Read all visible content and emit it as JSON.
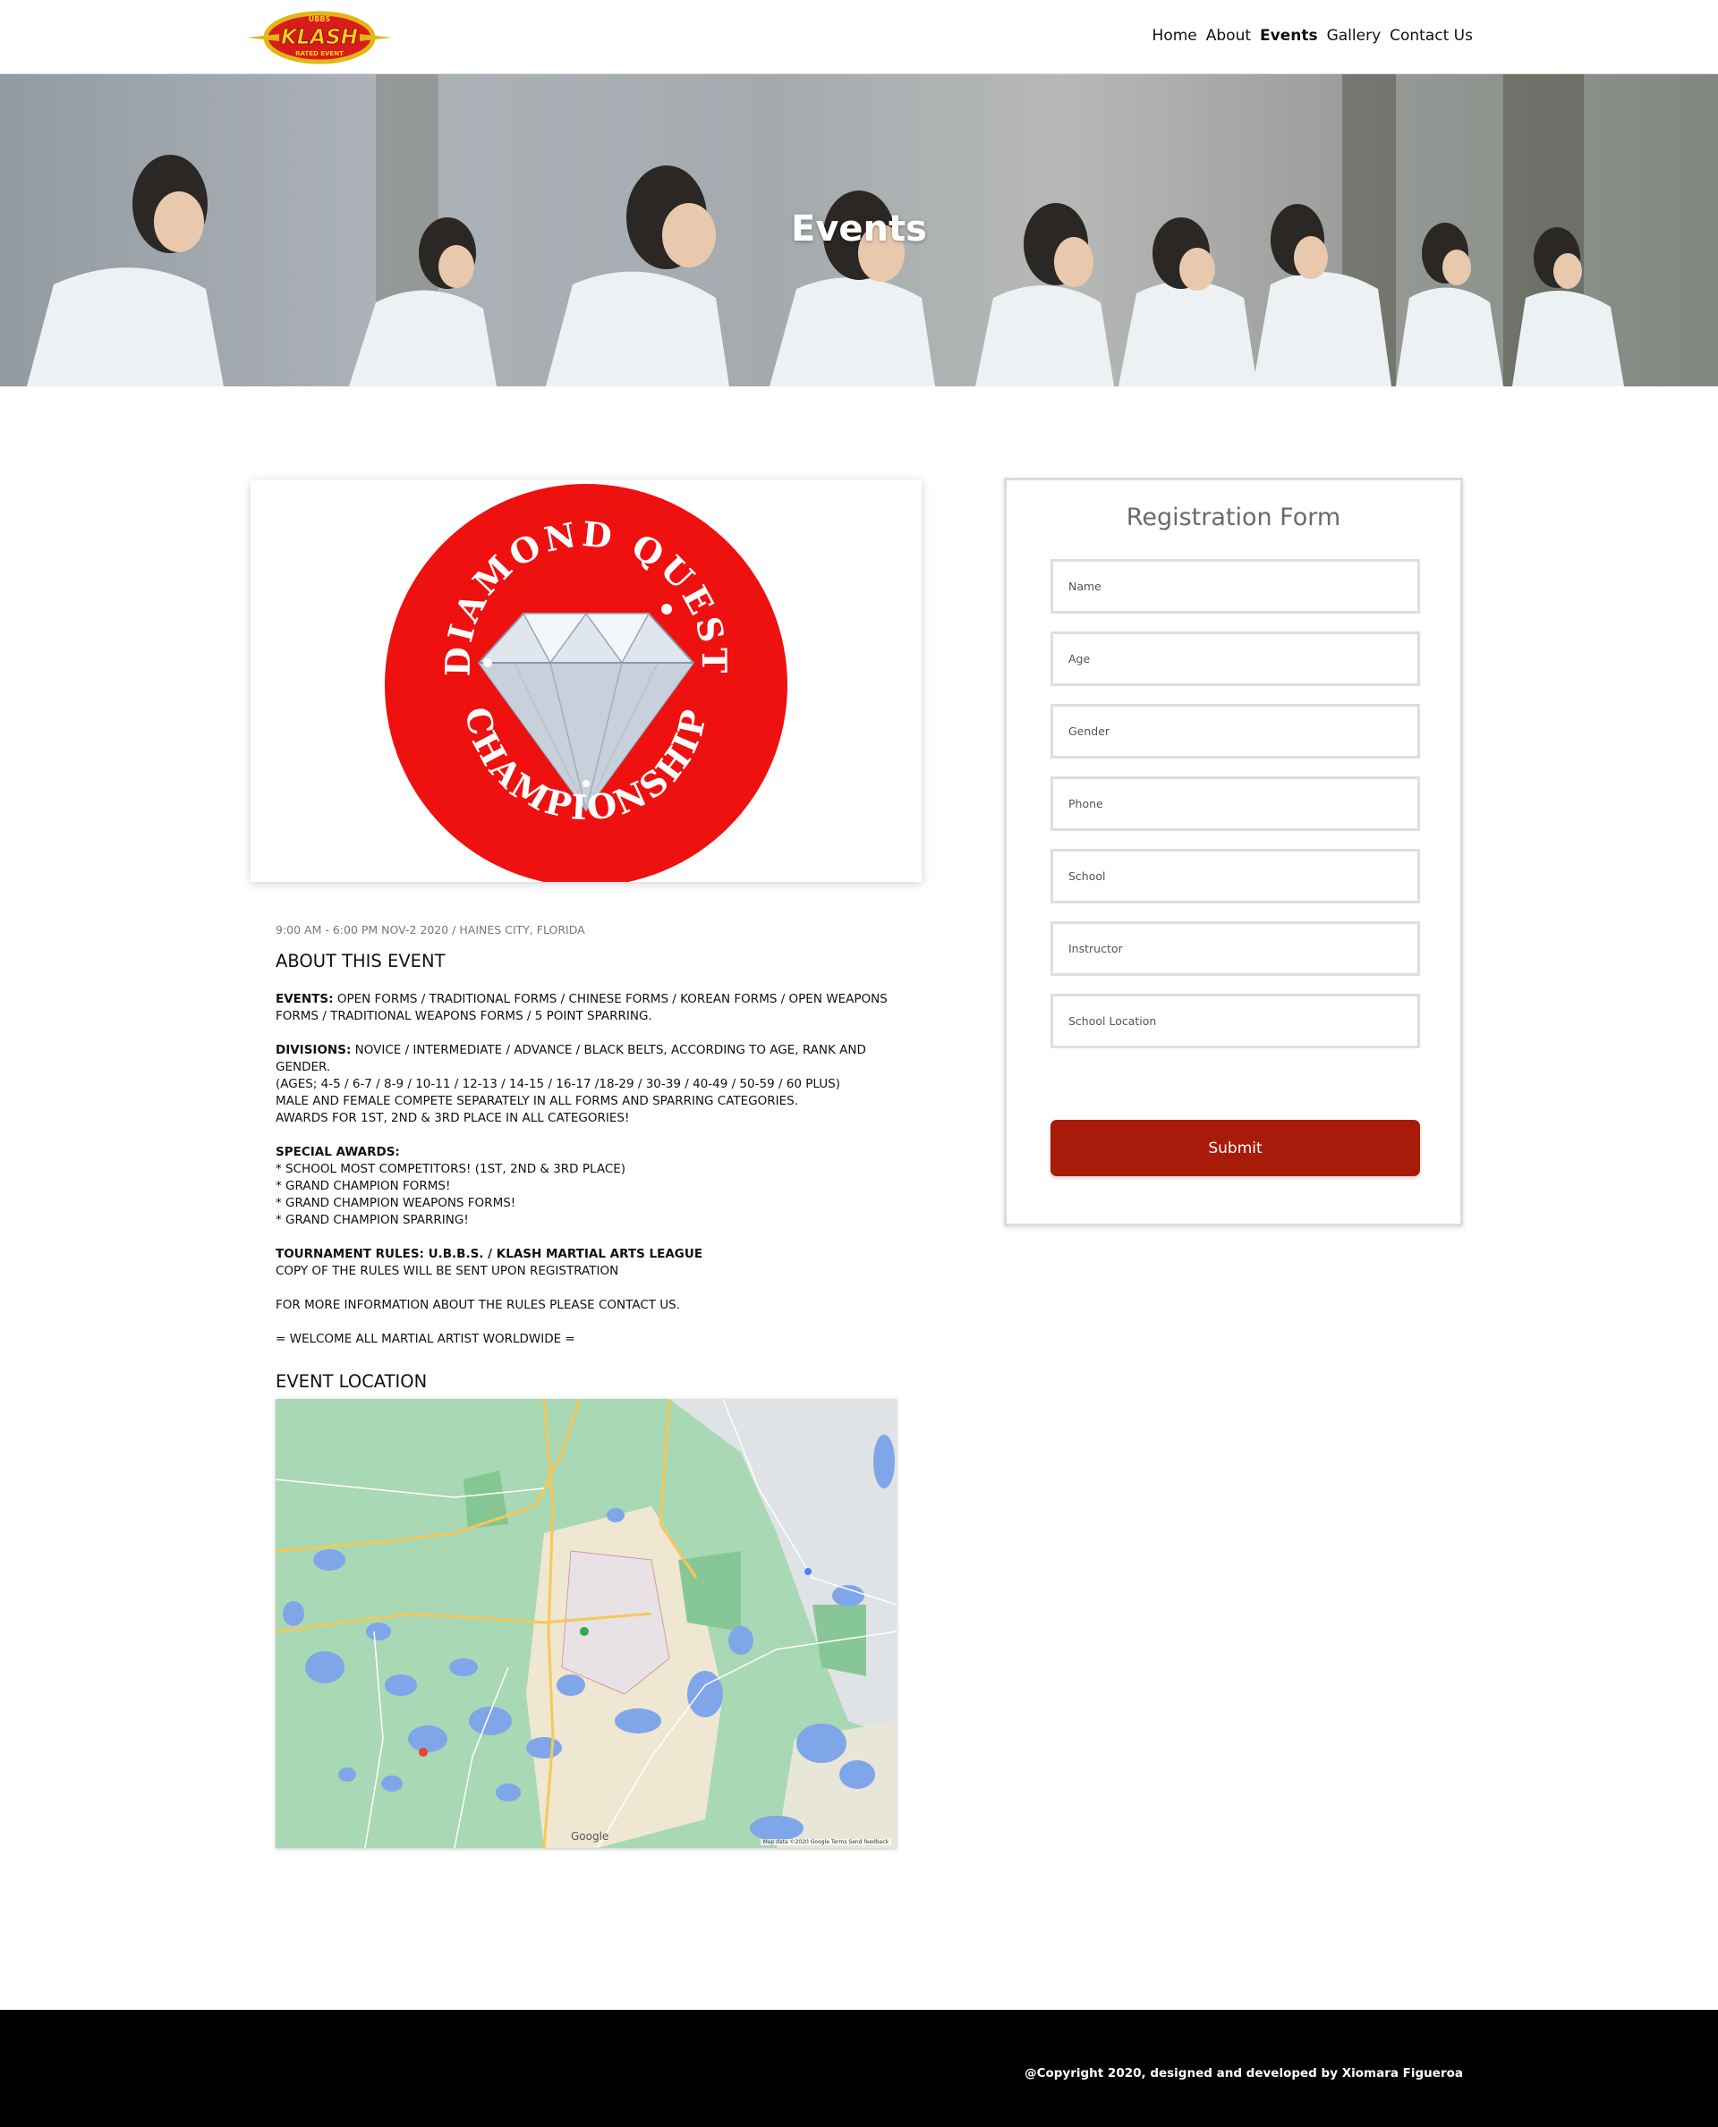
{
  "header": {
    "logo_text": "KLASH",
    "logo_top": "UBBS",
    "logo_bottom": "RATED EVENT",
    "nav": [
      {
        "label": "Home"
      },
      {
        "label": "About"
      },
      {
        "label": "Events",
        "active": true
      },
      {
        "label": "Gallery"
      },
      {
        "label": "Contact Us"
      }
    ]
  },
  "hero": {
    "title": "Events"
  },
  "event": {
    "logo_top_text": "DIAMOND QUEST",
    "logo_bottom_text": "CHAMPIONSHIP",
    "meta": "9:00 AM - 6:00 PM NOV-2 2020 / HAINES CITY, FLORIDA",
    "about_title": "ABOUT THIS EVENT",
    "events_label": "EVENTS:",
    "events_text": "OPEN FORMS / TRADITIONAL FORMS / CHINESE FORMS / KOREAN FORMS / OPEN WEAPONS FORMS / TRADITIONAL WEAPONS FORMS / 5 POINT SPARRING.",
    "divisions_label": "DIVISIONS:",
    "divisions_text": "NOVICE / INTERMEDIATE / ADVANCE / BLACK BELTS, ACCORDING TO AGE, RANK AND GENDER.",
    "divisions_lines": [
      "(AGES; 4-5 / 6-7 / 8-9 / 10-11 / 12-13 / 14-15 / 16-17 /18-29 / 30-39 / 40-49 / 50-59 / 60 PLUS)",
      "MALE AND FEMALE COMPETE SEPARATELY IN ALL FORMS AND SPARRING CATEGORIES.",
      "AWARDS FOR 1ST, 2ND & 3RD PLACE IN ALL CATEGORIES!"
    ],
    "special_label": "SPECIAL AWARDS:",
    "special_items": [
      "* SCHOOL MOST COMPETITORS! (1ST, 2ND & 3RD PLACE)",
      "* GRAND CHAMPION FORMS!",
      "* GRAND CHAMPION WEAPONS FORMS!",
      "* GRAND CHAMPION SPARRING!"
    ],
    "rules_label": "TOURNAMENT RULES: U.B.B.S. / KLASH MARTIAL ARTS LEAGUE",
    "rules_text": "COPY OF THE RULES WILL BE SENT UPON REGISTRATION",
    "contact_text": "FOR MORE INFORMATION ABOUT THE RULES PLEASE CONTACT US.",
    "welcome_text": "= WELCOME ALL MARTIAL ARTIST WORLDWIDE =",
    "location_title": "EVENT LOCATION"
  },
  "map": {
    "google_label": "Google",
    "footer_text": "Map data ©2020 Google   Terms   Send feedback"
  },
  "form": {
    "title": "Registration Form",
    "fields": [
      {
        "placeholder": "Name"
      },
      {
        "placeholder": "Age"
      },
      {
        "placeholder": "Gender"
      },
      {
        "placeholder": "Phone"
      },
      {
        "placeholder": "School"
      },
      {
        "placeholder": "Instructor"
      },
      {
        "placeholder": "School Location"
      }
    ],
    "submit_label": "Submit",
    "submit_color": "#a81b0a"
  },
  "footer": {
    "copyright": "@Copyright 2020, designed and developed by Xiomara Figueroa"
  }
}
